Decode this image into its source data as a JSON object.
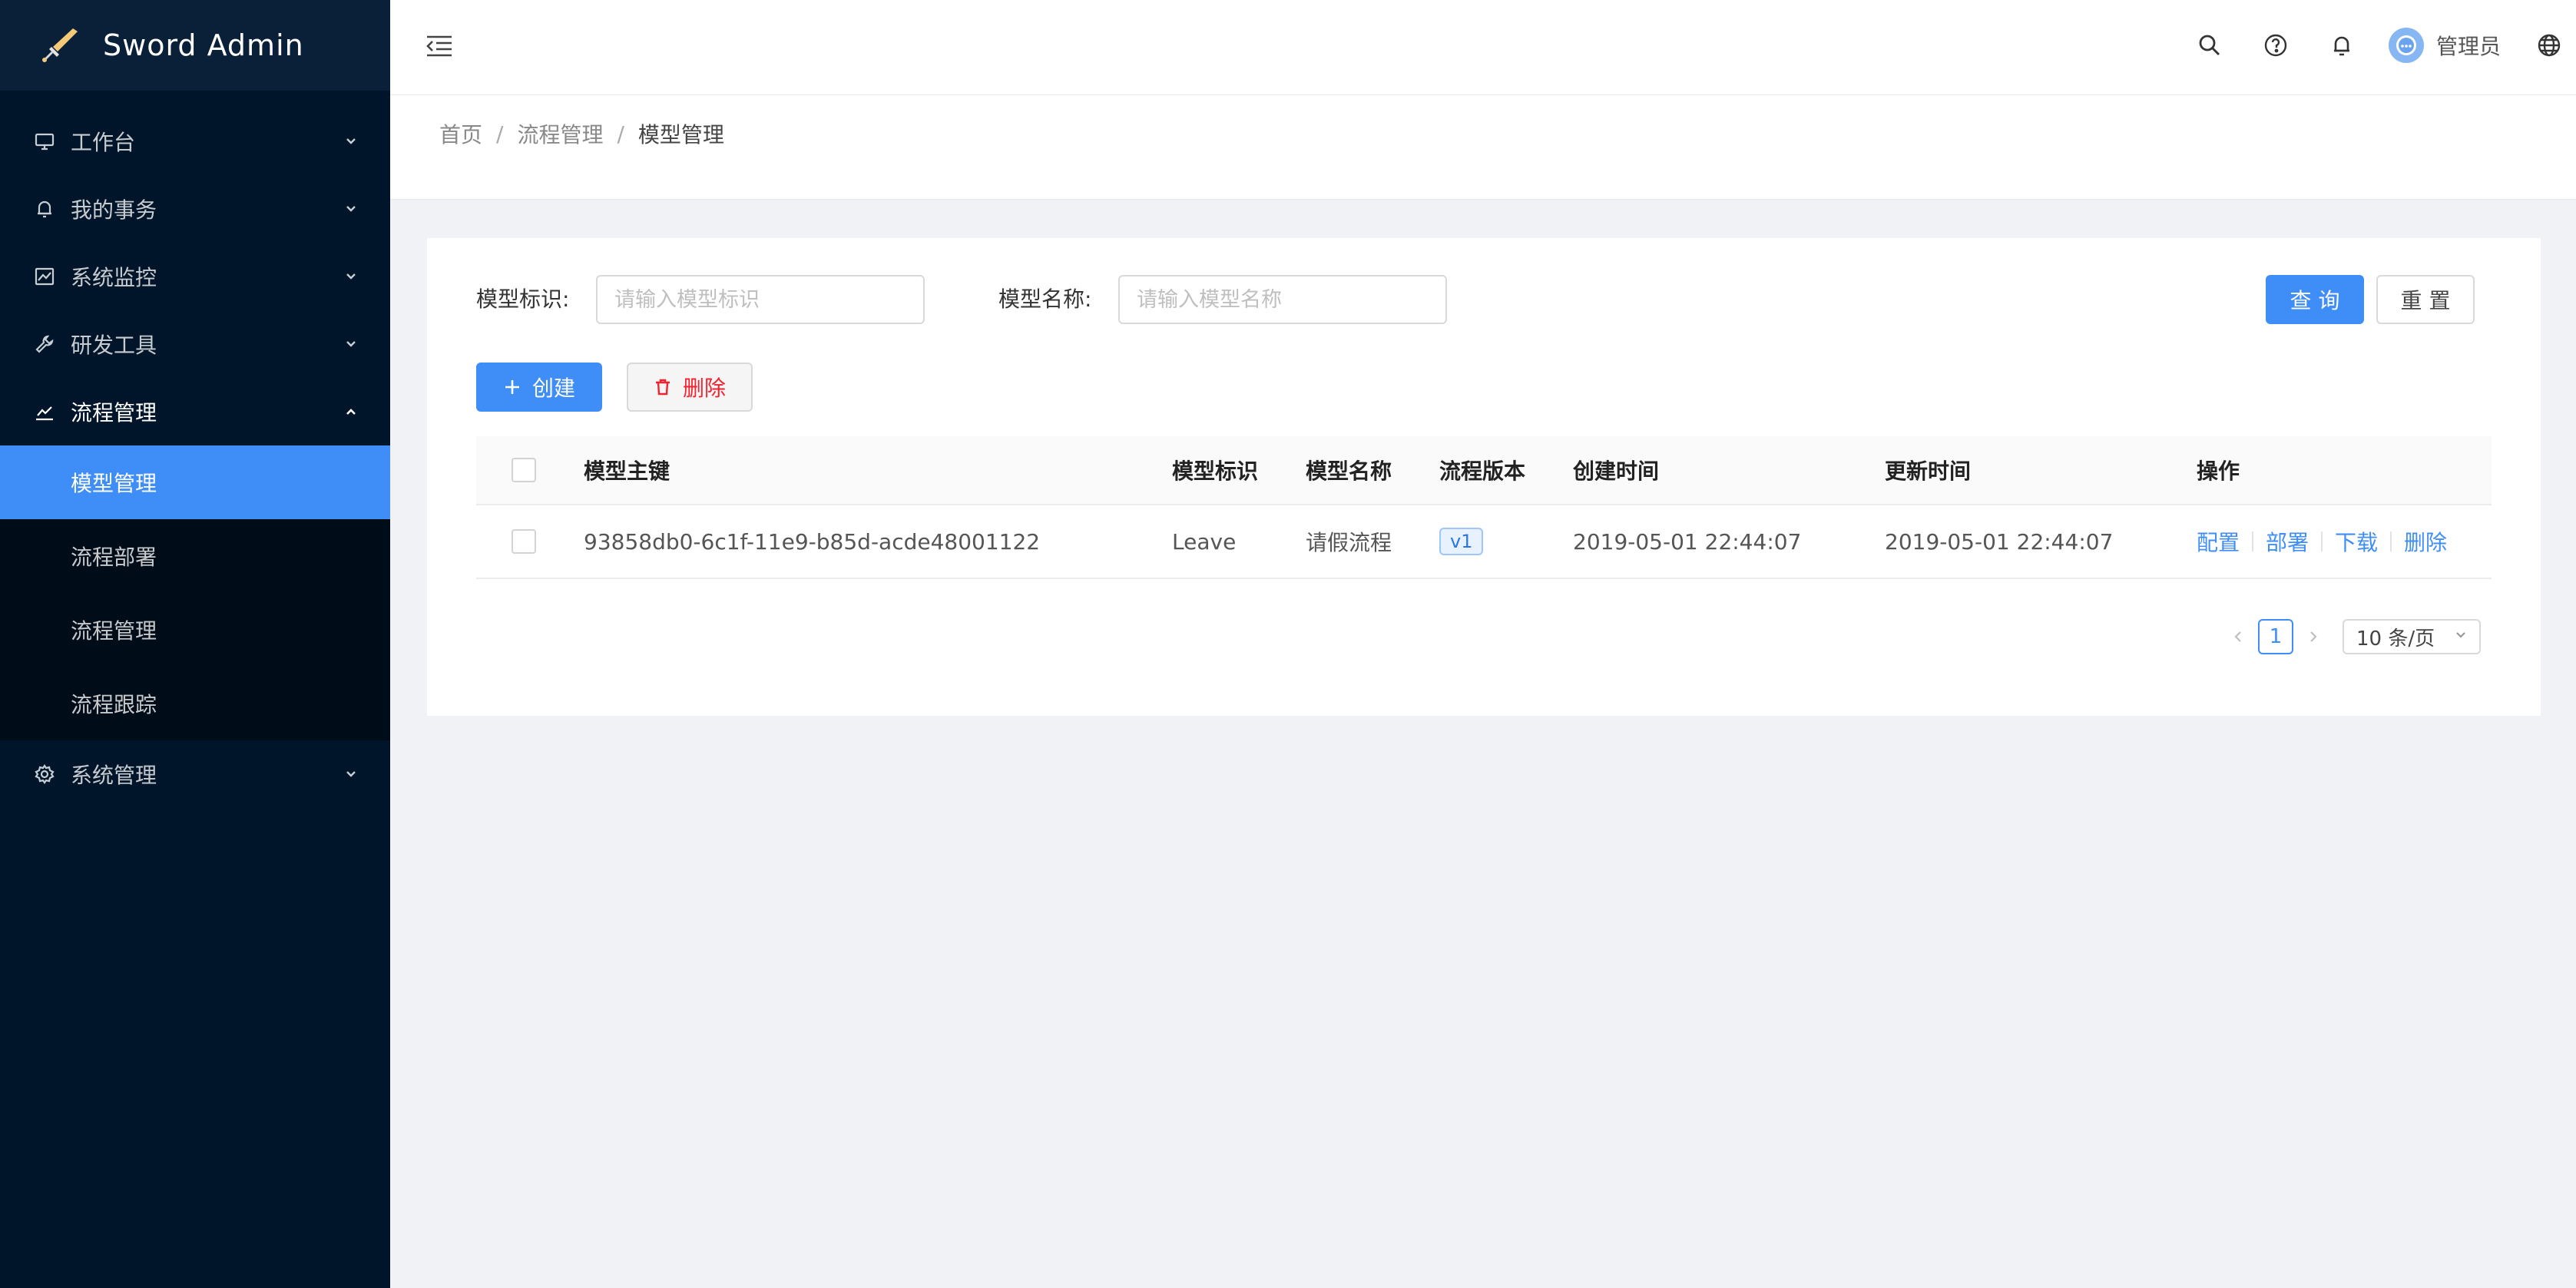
{
  "brand": {
    "title": "Sword Admin"
  },
  "sidebar": {
    "items": [
      {
        "label": "工作台",
        "icon": "monitor-icon"
      },
      {
        "label": "我的事务",
        "icon": "bell-icon"
      },
      {
        "label": "系统监控",
        "icon": "line-chart-icon"
      },
      {
        "label": "研发工具",
        "icon": "tool-icon"
      },
      {
        "label": "流程管理",
        "icon": "stock-icon",
        "open": true,
        "children": [
          {
            "label": "模型管理",
            "active": true
          },
          {
            "label": "流程部署"
          },
          {
            "label": "流程管理"
          },
          {
            "label": "流程跟踪"
          }
        ]
      },
      {
        "label": "系统管理",
        "icon": "setting-icon"
      }
    ]
  },
  "header": {
    "user_name": "管理员",
    "icons": [
      "search-icon",
      "question-circle-icon",
      "bell-icon",
      "globe-icon"
    ]
  },
  "breadcrumb": {
    "items": [
      "首页",
      "流程管理"
    ],
    "current": "模型管理"
  },
  "search": {
    "model_key_label": "模型标识:",
    "model_key_placeholder": "请输入模型标识",
    "model_key_value": "",
    "model_name_label": "模型名称:",
    "model_name_placeholder": "请输入模型名称",
    "model_name_value": "",
    "query_label": "查 询",
    "reset_label": "重 置"
  },
  "toolbar": {
    "create_label": "创建",
    "delete_label": "删除"
  },
  "table": {
    "columns": [
      "模型主键",
      "模型标识",
      "模型名称",
      "流程版本",
      "创建时间",
      "更新时间",
      "操作"
    ],
    "rows": [
      {
        "id": "93858db0-6c1f-11e9-b85d-acde48001122",
        "key": "Leave",
        "name": "请假流程",
        "version": "v1",
        "created": "2019-05-01 22:44:07",
        "updated": "2019-05-01 22:44:07",
        "actions": [
          "配置",
          "部署",
          "下载",
          "删除"
        ]
      }
    ]
  },
  "pagination": {
    "current": "1",
    "page_size": "10 条/页"
  },
  "colors": {
    "primary": "#3f8ef7",
    "sidebar_bg": "#001529",
    "danger": "#f5222d"
  }
}
